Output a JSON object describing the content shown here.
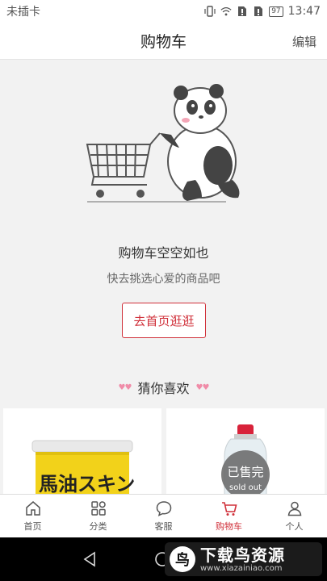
{
  "status_bar": {
    "carrier": "未插卡",
    "battery": "97",
    "time": "13:47"
  },
  "header": {
    "title": "购物车",
    "edit_label": "编辑"
  },
  "empty_state": {
    "title": "购物车空空如也",
    "subtitle": "快去挑选心爱的商品吧",
    "button_label": "去首页逛逛"
  },
  "recommend": {
    "title": "猜你喜欢",
    "products": [
      {
        "label_text": "馬油スキン"
      },
      {
        "badge": "已售完",
        "badge_sub": "sold out"
      }
    ]
  },
  "tabs": [
    {
      "label": "首页",
      "icon": "home-icon"
    },
    {
      "label": "分类",
      "icon": "grid-icon"
    },
    {
      "label": "客服",
      "icon": "chat-icon"
    },
    {
      "label": "购物车",
      "icon": "cart-icon",
      "active": true
    },
    {
      "label": "个人",
      "icon": "person-icon"
    }
  ],
  "watermark": {
    "text": "下载鸟资源",
    "url": "www.xiazainiao.com"
  },
  "colors": {
    "accent": "#d0303a",
    "background": "#f2f2f2"
  }
}
